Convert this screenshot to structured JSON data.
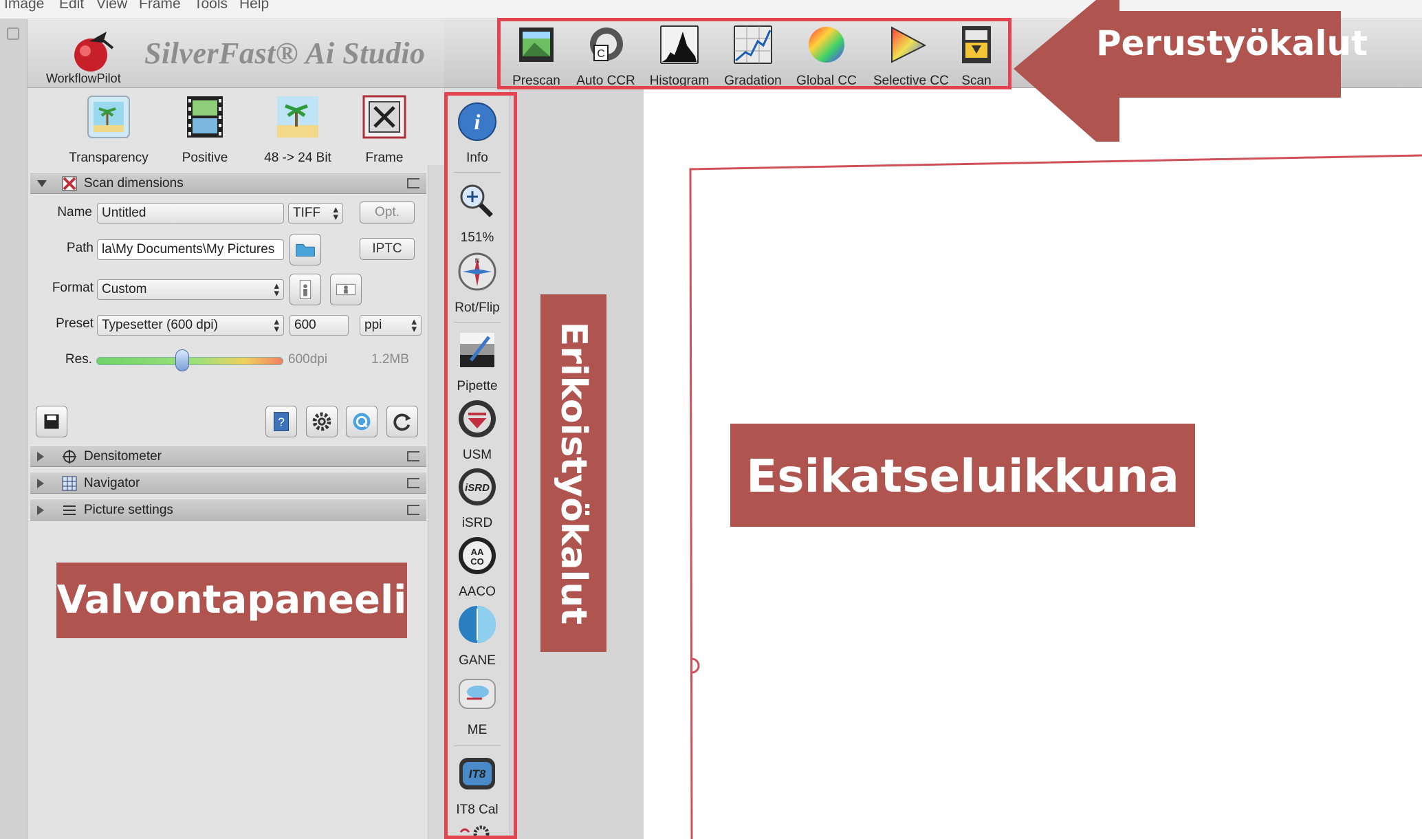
{
  "menu": [
    "Image",
    "Edit",
    "View",
    "Frame",
    "Tools",
    "Help"
  ],
  "app": {
    "brand": "SilverFast® Ai Studio",
    "workflow_pilot": "WorkflowPilot"
  },
  "top_tools": [
    {
      "label": "Prescan",
      "icon": "prescan-icon"
    },
    {
      "label": "Auto CCR",
      "icon": "auto-ccr-icon"
    },
    {
      "label": "Histogram",
      "icon": "histogram-icon"
    },
    {
      "label": "Gradation",
      "icon": "gradation-icon"
    },
    {
      "label": "Global CC",
      "icon": "global-cc-icon"
    },
    {
      "label": "Selective CC",
      "icon": "selective-cc-icon"
    },
    {
      "label": "Scan",
      "icon": "scan-icon"
    }
  ],
  "quick_buttons": [
    {
      "label": "Transparency",
      "icon": "transparency-icon"
    },
    {
      "label": "Positive",
      "icon": "film-strip-icon"
    },
    {
      "label": "48 -> 24 Bit",
      "icon": "bit-depth-icon"
    },
    {
      "label": "Frame",
      "icon": "frame-icon"
    }
  ],
  "scan_dimensions": {
    "title": "Scan dimensions",
    "name_label": "Name",
    "name_value": "Untitled",
    "file_type": "TIFF",
    "opt_button": "Opt.",
    "path_label": "Path",
    "path_value": "la\\My Documents\\My Pictures",
    "iptc_button": "IPTC",
    "format_label": "Format",
    "format_value": "Custom",
    "preset_label": "Preset",
    "preset_value": "Typesetter (600 dpi)",
    "preset_number": "600",
    "unit": "ppi",
    "res_label": "Res.",
    "res_value": "600dpi",
    "res_fraction": 0.46,
    "file_size": "1.2MB"
  },
  "sections": [
    {
      "label": "Densitometer",
      "icon": "densitometer-icon"
    },
    {
      "label": "Navigator",
      "icon": "navigator-icon"
    },
    {
      "label": "Picture settings",
      "icon": "picture-settings-icon"
    }
  ],
  "side_tools": [
    {
      "label": "Info",
      "icon": "info-icon"
    },
    {
      "label": "151%",
      "icon": "zoom-icon"
    },
    {
      "label": "Rot/Flip",
      "icon": "rotate-flip-icon"
    },
    {
      "label": "Pipette",
      "icon": "pipette-icon"
    },
    {
      "label": "USM",
      "icon": "usm-icon"
    },
    {
      "label": "iSRD",
      "icon": "isrd-icon"
    },
    {
      "label": "AACO",
      "icon": "aaco-icon"
    },
    {
      "label": "GANE",
      "icon": "gane-icon"
    },
    {
      "label": "ME",
      "icon": "me-icon"
    },
    {
      "label": "IT8 Cal",
      "icon": "it8-cal-icon"
    }
  ],
  "annotations": {
    "basic_tools": "Perustyökalut",
    "special_tools": "Erikoistyökalut",
    "preview_window": "Esikatseluikkuna",
    "control_panel": "Valvontapaneeli"
  },
  "colors": {
    "annotation_fill": "#b0544f",
    "highlight_border": "#e2434f"
  }
}
